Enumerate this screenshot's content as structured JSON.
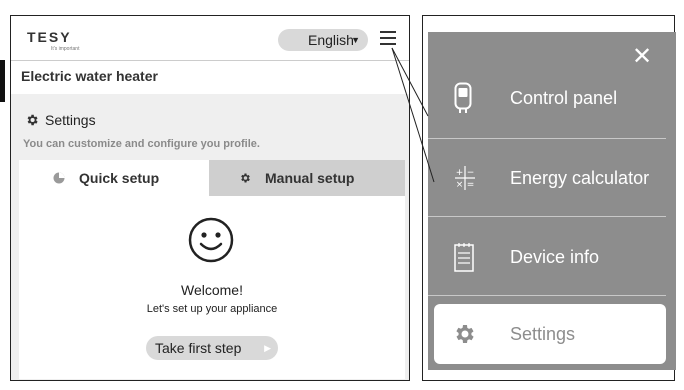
{
  "app": {
    "logo": "TESY",
    "tagline": "It's important",
    "language": "English",
    "device_title": "Electric water heater"
  },
  "settings": {
    "title": "Settings",
    "subtitle": "You can customize and configure you profile."
  },
  "tabs": [
    {
      "label": "Quick setup",
      "active": true
    },
    {
      "label": "Manual setup",
      "active": false
    }
  ],
  "welcome": {
    "title": "Welcome!",
    "subtitle": "Let's set up your appliance",
    "button": "Take first step"
  },
  "menu": {
    "close_icon": "close-icon",
    "items": [
      {
        "label": "Control panel",
        "icon": "water-heater-icon"
      },
      {
        "label": "Energy calculator",
        "icon": "calculator-icon"
      },
      {
        "label": "Device info",
        "icon": "document-icon"
      },
      {
        "label": "Settings",
        "icon": "gear-icon",
        "active": true
      }
    ]
  },
  "colors": {
    "menu_bg": "#8d8d8d",
    "tab_inactive": "#cfcfcf",
    "pill": "#d9d9d9"
  }
}
